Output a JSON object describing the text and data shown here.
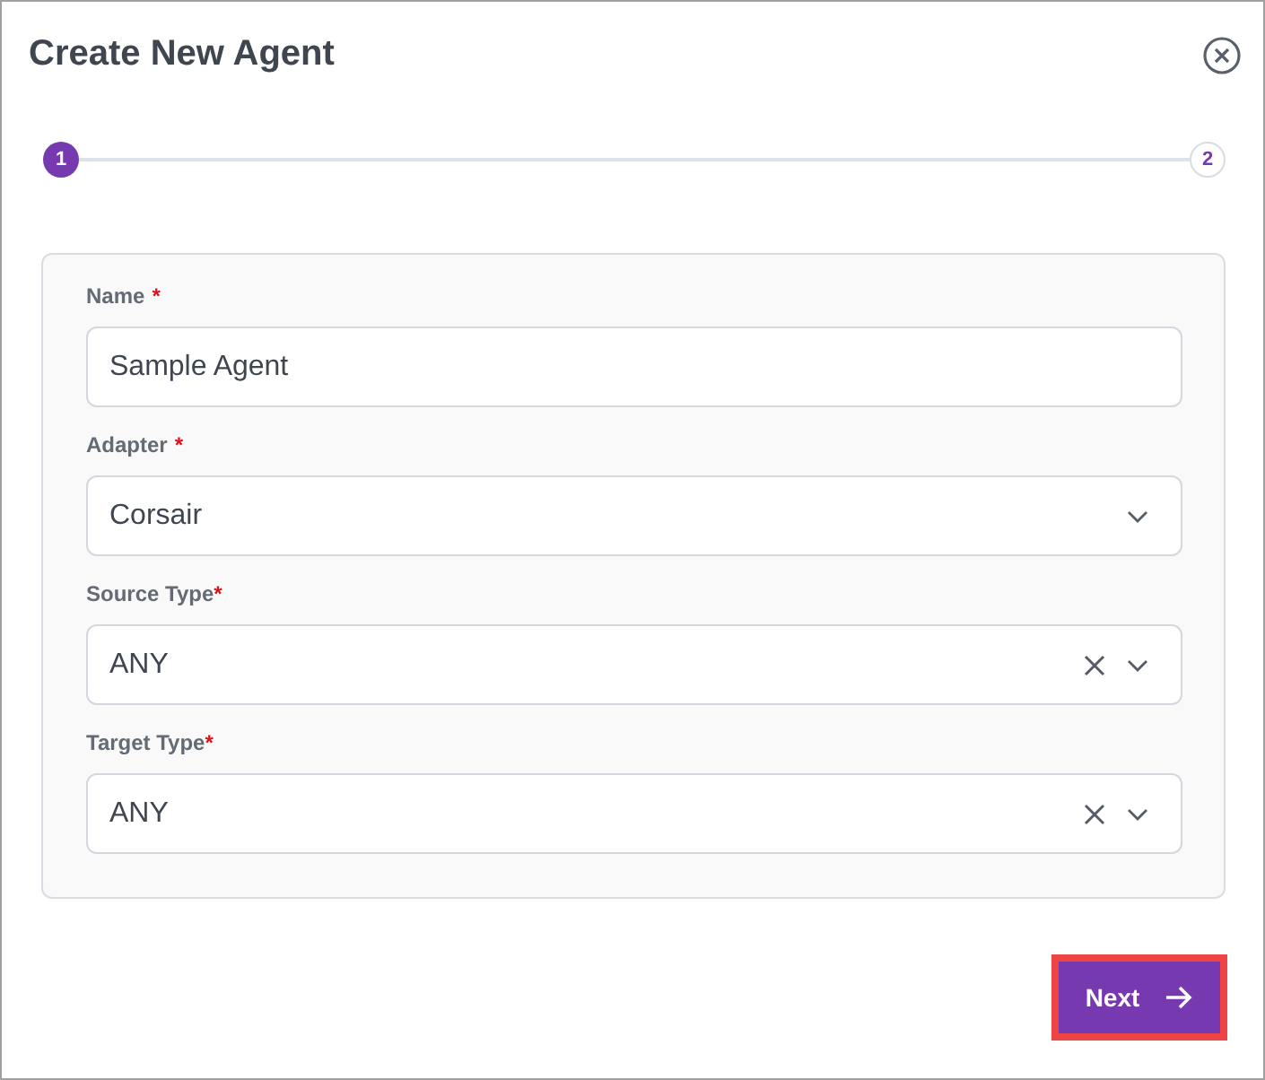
{
  "dialog": {
    "title": "Create New Agent"
  },
  "steps": [
    {
      "label": "1",
      "selected": true
    },
    {
      "label": "2",
      "selected": false
    }
  ],
  "fields": [
    {
      "kind": "text",
      "label": "Name",
      "required": "*",
      "spaced_mark": true,
      "value": "Sample Agent"
    },
    {
      "kind": "select",
      "label": "Adapter",
      "required": "*",
      "spaced_mark": true,
      "value": "Corsair",
      "clearable": false
    },
    {
      "kind": "select",
      "label": "Source Type",
      "required": "*",
      "spaced_mark": false,
      "value": "ANY",
      "clearable": true
    },
    {
      "kind": "select",
      "label": "Target Type",
      "required": "*",
      "spaced_mark": false,
      "value": "ANY",
      "clearable": true
    }
  ],
  "next_button": {
    "label": "Next",
    "highlighted": true
  }
}
